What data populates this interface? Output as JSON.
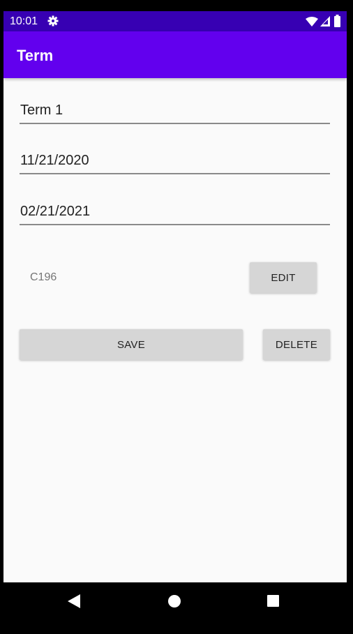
{
  "status_bar": {
    "time": "10:01",
    "icons": [
      "gear-icon",
      "wifi-icon",
      "signal-icon",
      "battery-icon"
    ]
  },
  "app_bar": {
    "title": "Term"
  },
  "form": {
    "term_name": "Term 1",
    "start_date": "11/21/2020",
    "end_date": "02/21/2021"
  },
  "course": {
    "label": "C196",
    "edit_button": "EDIT"
  },
  "actions": {
    "save_button": "SAVE",
    "delete_button": "DELETE"
  },
  "nav_bar": {
    "icons": [
      "back-icon",
      "home-icon",
      "recents-icon"
    ]
  },
  "colors": {
    "status_bar": "#3700b3",
    "app_bar": "#6200ee",
    "background": "#fafafa",
    "button": "#d6d6d6"
  }
}
